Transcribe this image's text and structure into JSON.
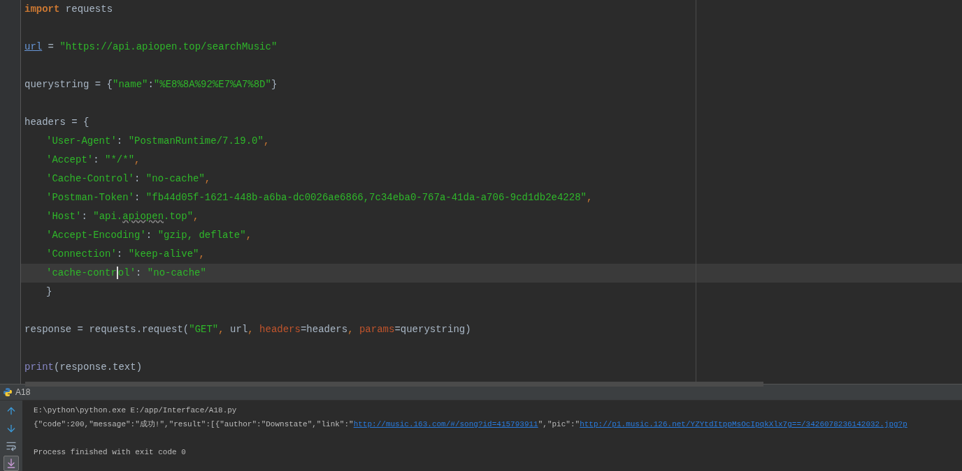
{
  "editor": {
    "lines": [
      {
        "kind": "code",
        "current": false,
        "indented": false,
        "tokens": [
          {
            "kind": "keyword",
            "text": "import"
          },
          {
            "kind": "plain",
            "text": " requests"
          }
        ]
      },
      {
        "kind": "blank",
        "current": false
      },
      {
        "kind": "code",
        "current": false,
        "indented": false,
        "tokens": [
          {
            "kind": "variable",
            "text": "url"
          },
          {
            "kind": "plain",
            "text": " = "
          },
          {
            "kind": "string",
            "text": "\"https://api.apiopen.top/searchMusic\""
          }
        ]
      },
      {
        "kind": "blank",
        "current": false
      },
      {
        "kind": "code",
        "current": false,
        "indented": false,
        "tokens": [
          {
            "kind": "plain",
            "text": "querystring = {"
          },
          {
            "kind": "string",
            "text": "\"name\""
          },
          {
            "kind": "plain",
            "text": ":"
          },
          {
            "kind": "string",
            "text": "\"%E8%8A%92%E7%A7%8D\""
          },
          {
            "kind": "plain",
            "text": "}"
          }
        ]
      },
      {
        "kind": "blank",
        "current": false
      },
      {
        "kind": "code",
        "current": false,
        "indented": false,
        "tokens": [
          {
            "kind": "plain",
            "text": "headers = {"
          }
        ]
      },
      {
        "kind": "code",
        "current": false,
        "indented": true,
        "tokens": [
          {
            "kind": "string",
            "text": "'User-Agent'"
          },
          {
            "kind": "plain",
            "text": ": "
          },
          {
            "kind": "string",
            "text": "\"PostmanRuntime/7.19.0\""
          },
          {
            "kind": "punct",
            "text": ","
          }
        ]
      },
      {
        "kind": "code",
        "current": false,
        "indented": true,
        "tokens": [
          {
            "kind": "string",
            "text": "'Accept'"
          },
          {
            "kind": "plain",
            "text": ": "
          },
          {
            "kind": "string",
            "text": "\"*/*\""
          },
          {
            "kind": "punct",
            "text": ","
          }
        ]
      },
      {
        "kind": "code",
        "current": false,
        "indented": true,
        "tokens": [
          {
            "kind": "string",
            "text": "'Cache-Control'"
          },
          {
            "kind": "plain",
            "text": ": "
          },
          {
            "kind": "string",
            "text": "\"no-cache\""
          },
          {
            "kind": "punct",
            "text": ","
          }
        ]
      },
      {
        "kind": "code",
        "current": false,
        "indented": true,
        "tokens": [
          {
            "kind": "string",
            "text": "'Postman-Token'"
          },
          {
            "kind": "plain",
            "text": ": "
          },
          {
            "kind": "string",
            "text": "\"fb44d05f-1621-448b-a6ba-dc0026ae6866,7c34eba0-767a-41da-a706-9cd1db2e4228\""
          },
          {
            "kind": "punct",
            "text": ","
          }
        ]
      },
      {
        "kind": "code",
        "current": false,
        "indented": true,
        "tokens": [
          {
            "kind": "string",
            "text": "'Host'"
          },
          {
            "kind": "plain",
            "text": ": "
          },
          {
            "kind": "string",
            "text": "\"api."
          },
          {
            "kind": "typo",
            "text": "apiopen"
          },
          {
            "kind": "string",
            "text": ".top\""
          },
          {
            "kind": "punct",
            "text": ","
          }
        ]
      },
      {
        "kind": "code",
        "current": false,
        "indented": true,
        "tokens": [
          {
            "kind": "string",
            "text": "'Accept-Encoding'"
          },
          {
            "kind": "plain",
            "text": ": "
          },
          {
            "kind": "string",
            "text": "\"gzip, deflate\""
          },
          {
            "kind": "punct",
            "text": ","
          }
        ]
      },
      {
        "kind": "code",
        "current": false,
        "indented": true,
        "tokens": [
          {
            "kind": "string",
            "text": "'Connection'"
          },
          {
            "kind": "plain",
            "text": ": "
          },
          {
            "kind": "string",
            "text": "\"keep-alive\""
          },
          {
            "kind": "punct",
            "text": ","
          }
        ]
      },
      {
        "kind": "code",
        "current": true,
        "indented": true,
        "tokens": [
          {
            "kind": "string",
            "text": "'cache-contr"
          },
          {
            "kind": "caret"
          },
          {
            "kind": "string",
            "text": "ol'"
          },
          {
            "kind": "plain",
            "text": ": "
          },
          {
            "kind": "string",
            "text": "\"no-cache\""
          }
        ]
      },
      {
        "kind": "code",
        "current": false,
        "indented": true,
        "tokens": [
          {
            "kind": "plain",
            "text": "}"
          }
        ]
      },
      {
        "kind": "blank",
        "current": false
      },
      {
        "kind": "code",
        "current": false,
        "indented": false,
        "tokens": [
          {
            "kind": "plain",
            "text": "response = requests.request("
          },
          {
            "kind": "string",
            "text": "\"GET\""
          },
          {
            "kind": "punct",
            "text": ", "
          },
          {
            "kind": "plain",
            "text": "url"
          },
          {
            "kind": "punct",
            "text": ", "
          },
          {
            "kind": "param",
            "text": "headers"
          },
          {
            "kind": "plain",
            "text": "=headers"
          },
          {
            "kind": "punct",
            "text": ", "
          },
          {
            "kind": "param",
            "text": "params"
          },
          {
            "kind": "plain",
            "text": "=querystring)"
          }
        ]
      },
      {
        "kind": "blank",
        "current": false
      },
      {
        "kind": "code",
        "current": false,
        "indented": false,
        "tokens": [
          {
            "kind": "builtin",
            "text": "print"
          },
          {
            "kind": "plain",
            "text": "(response.text)"
          }
        ]
      }
    ]
  },
  "run_panel": {
    "title": "A18",
    "toolbar": [
      {
        "kind": "up",
        "selected": false
      },
      {
        "kind": "down",
        "selected": false
      },
      {
        "kind": "wrap",
        "selected": false
      },
      {
        "kind": "scroll-end",
        "selected": true
      }
    ],
    "output": [
      {
        "kind": "command",
        "parts": [
          {
            "kind": "text",
            "text": "E:\\python\\python.exe E:/app/Interface/A18.py"
          }
        ]
      },
      {
        "kind": "result",
        "parts": [
          {
            "kind": "text",
            "text": "{\"code\":200,\"message\":\"成功!\",\"result\":[{\"author\":\"Downstate\",\"link\":\""
          },
          {
            "kind": "link",
            "text": "http://music.163.com/#/song?id=415793911"
          },
          {
            "kind": "text",
            "text": "\",\"pic\":\""
          },
          {
            "kind": "link",
            "text": "http://p1.music.126.net/YZYtdItppMsOcIpqkXlx7g==/3426078236142032.jpg?p"
          }
        ]
      },
      {
        "kind": "blank"
      },
      {
        "kind": "status",
        "parts": [
          {
            "kind": "text",
            "text": "Process finished with exit code 0"
          }
        ]
      }
    ]
  }
}
